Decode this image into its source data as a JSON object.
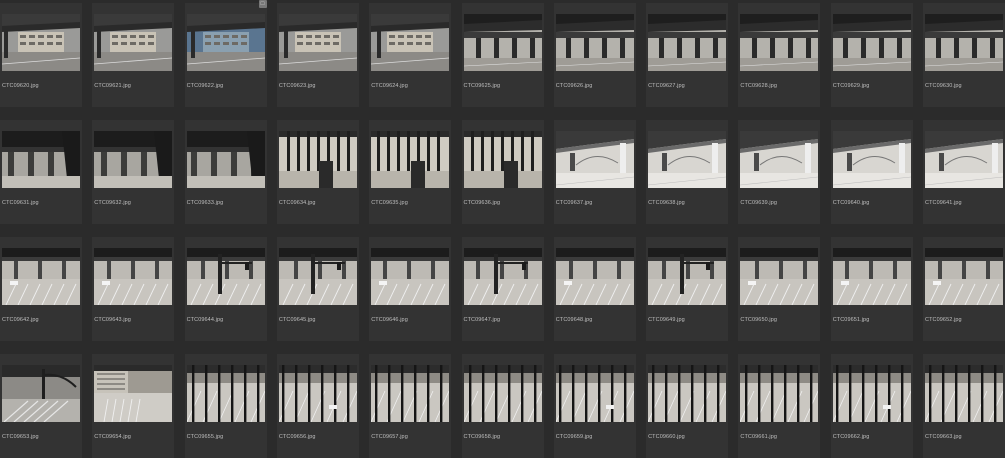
{
  "browser": {
    "badge_symbol": "□",
    "files": [
      {
        "name": "CTC09620.jpg",
        "scene": "building"
      },
      {
        "name": "CTC09621.jpg",
        "scene": "building"
      },
      {
        "name": "CTC09622.jpg",
        "scene": "building-blue"
      },
      {
        "name": "CTC09623.jpg",
        "scene": "building"
      },
      {
        "name": "CTC09624.jpg",
        "scene": "building"
      },
      {
        "name": "CTC09625.jpg",
        "scene": "overpass"
      },
      {
        "name": "CTC09626.jpg",
        "scene": "overpass"
      },
      {
        "name": "CTC09627.jpg",
        "scene": "overpass"
      },
      {
        "name": "CTC09628.jpg",
        "scene": "overpass"
      },
      {
        "name": "CTC09629.jpg",
        "scene": "overpass"
      },
      {
        "name": "CTC09630.jpg",
        "scene": "overpass"
      },
      {
        "name": "CTC09631.jpg",
        "scene": "underpass"
      },
      {
        "name": "CTC09632.jpg",
        "scene": "underpass"
      },
      {
        "name": "CTC09633.jpg",
        "scene": "underpass"
      },
      {
        "name": "CTC09634.jpg",
        "scene": "bars"
      },
      {
        "name": "CTC09635.jpg",
        "scene": "bars"
      },
      {
        "name": "CTC09636.jpg",
        "scene": "bars"
      },
      {
        "name": "CTC09637.jpg",
        "scene": "bright"
      },
      {
        "name": "CTC09638.jpg",
        "scene": "bright"
      },
      {
        "name": "CTC09639.jpg",
        "scene": "bright"
      },
      {
        "name": "CTC09640.jpg",
        "scene": "bright"
      },
      {
        "name": "CTC09641.jpg",
        "scene": "bright"
      },
      {
        "name": "CTC09642.jpg",
        "scene": "street"
      },
      {
        "name": "CTC09643.jpg",
        "scene": "street"
      },
      {
        "name": "CTC09644.jpg",
        "scene": "signals"
      },
      {
        "name": "CTC09645.jpg",
        "scene": "signals"
      },
      {
        "name": "CTC09646.jpg",
        "scene": "street"
      },
      {
        "name": "CTC09647.jpg",
        "scene": "signals"
      },
      {
        "name": "CTC09648.jpg",
        "scene": "street"
      },
      {
        "name": "CTC09649.jpg",
        "scene": "signals"
      },
      {
        "name": "CTC09650.jpg",
        "scene": "street"
      },
      {
        "name": "CTC09651.jpg",
        "scene": "street"
      },
      {
        "name": "CTC09652.jpg",
        "scene": "street"
      },
      {
        "name": "CTC09653.jpg",
        "scene": "crosswalk"
      },
      {
        "name": "CTC09654.jpg",
        "scene": "plaza"
      },
      {
        "name": "CTC09655.jpg",
        "scene": "fence"
      },
      {
        "name": "CTC09656.jpg",
        "scene": "fence"
      },
      {
        "name": "CTC09657.jpg",
        "scene": "fence"
      },
      {
        "name": "CTC09658.jpg",
        "scene": "fence"
      },
      {
        "name": "CTC09659.jpg",
        "scene": "fence"
      },
      {
        "name": "CTC09660.jpg",
        "scene": "fence"
      },
      {
        "name": "CTC09661.jpg",
        "scene": "fence"
      },
      {
        "name": "CTC09662.jpg",
        "scene": "fence"
      },
      {
        "name": "CTC09663.jpg",
        "scene": "fence"
      }
    ]
  }
}
